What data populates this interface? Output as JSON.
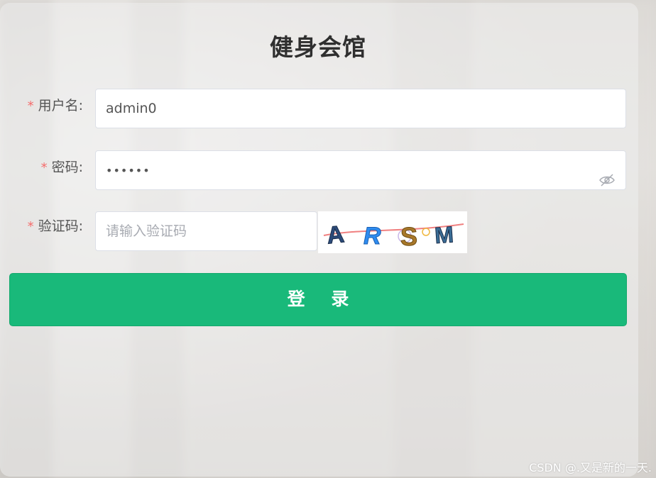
{
  "title": "健身会馆",
  "form": {
    "username": {
      "required_mark": "*",
      "label": "用户名:",
      "value": "admin0"
    },
    "password": {
      "required_mark": "*",
      "label": "密码:",
      "value": "••••••",
      "toggle_icon": "eye-hidden-icon"
    },
    "captcha": {
      "required_mark": "*",
      "label": "验证码:",
      "placeholder": "请输入验证码",
      "image_text": "ARSM"
    },
    "submit_label": "登 录"
  },
  "watermark": "CSDN @.又是新的一天.",
  "colors": {
    "primary": "#19b97a",
    "required": "#f56c6c"
  }
}
